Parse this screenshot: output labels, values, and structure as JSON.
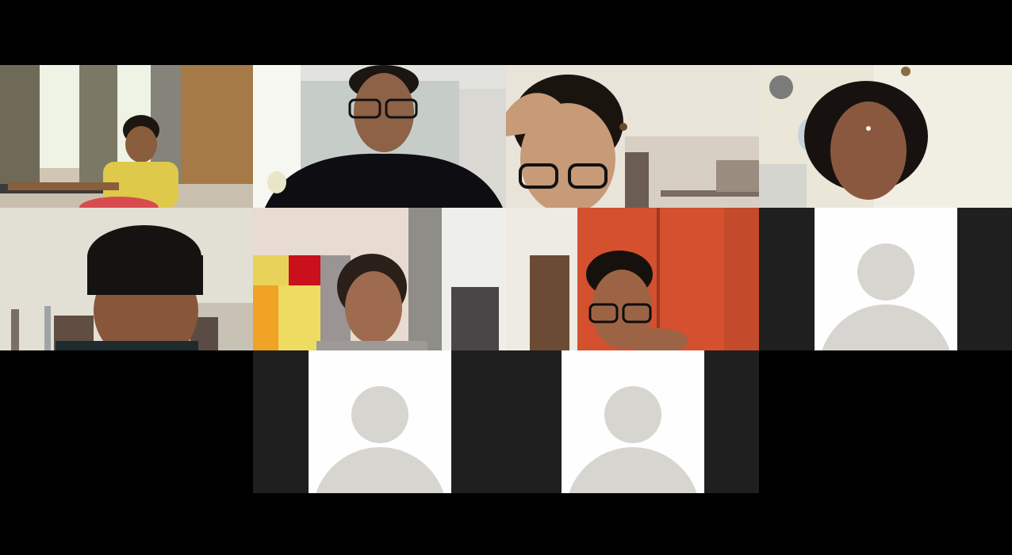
{
  "meeting": {
    "view": "gallery",
    "participants": [
      {
        "kind": "video",
        "description_icon": "video-feed"
      },
      {
        "kind": "video",
        "description_icon": "video-feed"
      },
      {
        "kind": "video",
        "description_icon": "video-feed"
      },
      {
        "kind": "video",
        "description_icon": "video-feed"
      },
      {
        "kind": "video",
        "description_icon": "video-feed"
      },
      {
        "kind": "video",
        "description_icon": "video-feed"
      },
      {
        "kind": "video",
        "description_icon": "video-feed"
      },
      {
        "kind": "avatar",
        "description_icon": "default-avatar-icon"
      },
      {
        "kind": "avatar",
        "description_icon": "default-avatar-icon"
      },
      {
        "kind": "avatar",
        "description_icon": "default-avatar-icon"
      }
    ]
  },
  "colors": {
    "background": "#000000",
    "placeholder_bg": "#1f1f1f",
    "avatar_card": "#fefefe",
    "avatar_silhouette": "#d7d5d0"
  }
}
